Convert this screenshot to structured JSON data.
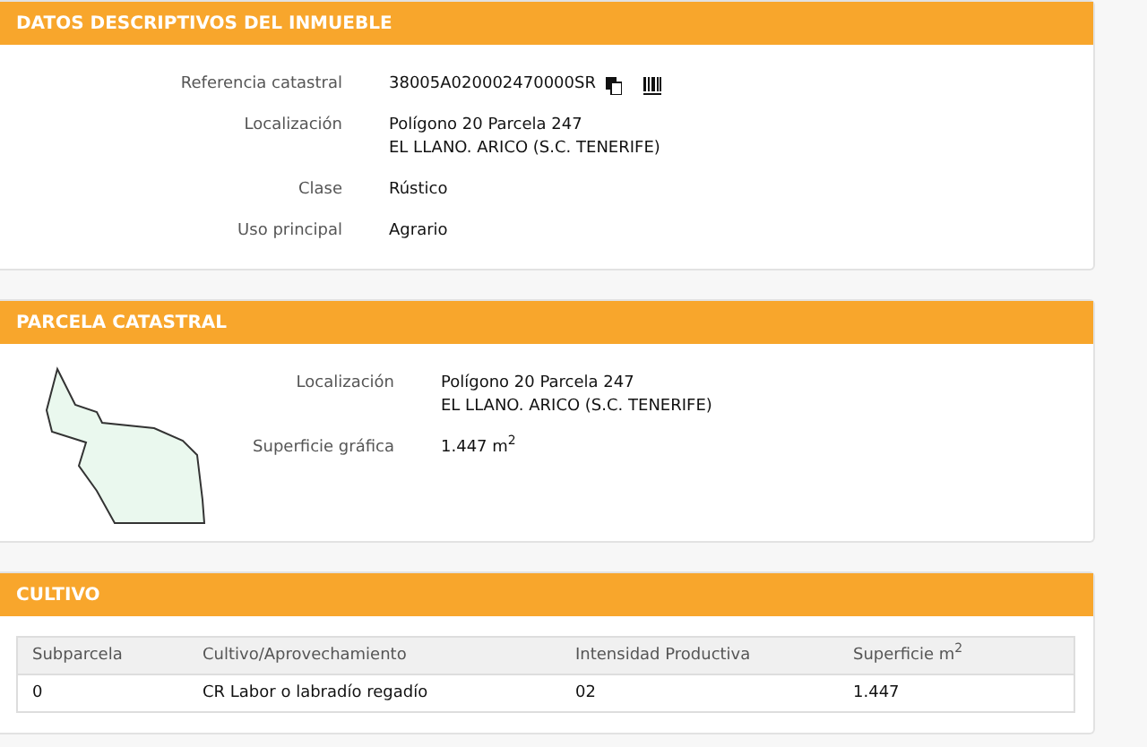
{
  "sections": [
    {
      "title": "DATOS DESCRIPTIVOS DEL INMUEBLE",
      "kind": "fields",
      "fields": [
        {
          "label": "Referencia catastral",
          "lines": [
            "38005A020002470000SR"
          ],
          "icons": true
        },
        {
          "label": "Localización",
          "lines": [
            "Polígono 20 Parcela 247",
            "EL LLANO. ARICO (S.C. TENERIFE)"
          ]
        },
        {
          "label": "Clase",
          "lines": [
            "Rústico"
          ]
        },
        {
          "label": "Uso principal",
          "lines": [
            "Agrario"
          ]
        }
      ]
    },
    {
      "title": "PARCELA CATASTRAL",
      "kind": "parcel",
      "fields": [
        {
          "label": "Localización",
          "lines": [
            "Polígono 20 Parcela 247",
            "EL LLANO. ARICO (S.C. TENERIFE)"
          ]
        },
        {
          "label": "Superficie gráfica",
          "lines": [
            "1.447 m$^{2}$"
          ]
        }
      ]
    },
    {
      "title": "CULTIVO",
      "kind": "table",
      "columns": [
        "Subparcela",
        "Cultivo/Aprovechamiento",
        "Intensidad Productiva",
        "Superficie m$^{2}$"
      ],
      "rows": [
        [
          "0",
          "CR Labor o labradío regadío",
          "02",
          "1.447"
        ]
      ]
    }
  ]
}
